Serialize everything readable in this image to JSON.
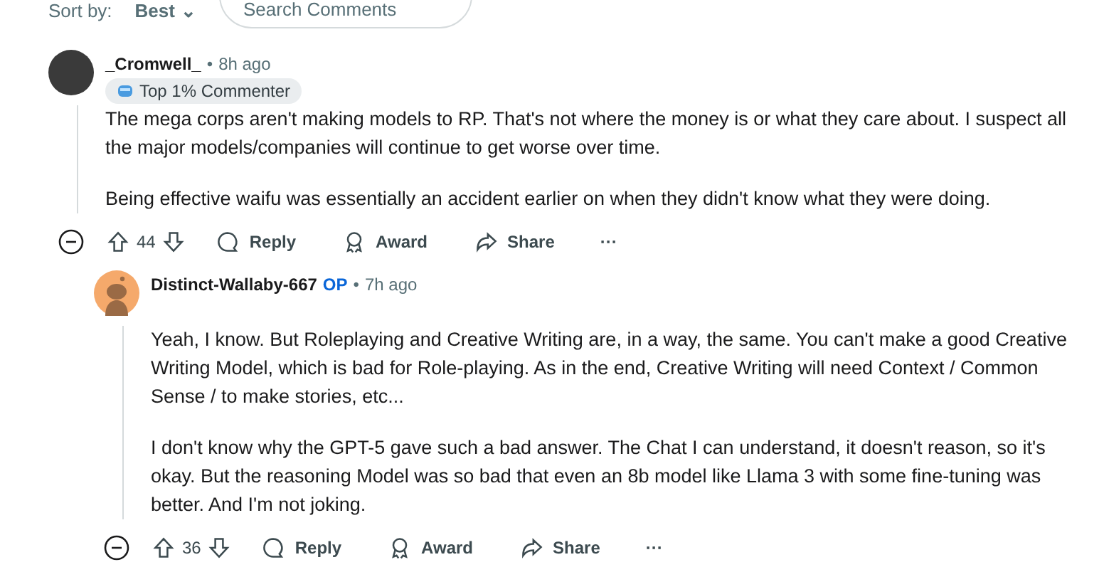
{
  "sort": {
    "label": "Sort by:",
    "value": "Best",
    "caret": "⌄"
  },
  "search": {
    "placeholder": "Search Comments"
  },
  "comments": [
    {
      "author": "_Cromwell_",
      "op": false,
      "separator": "•",
      "time": "8h ago",
      "avatar_photo": true,
      "flair": "Top 1% Commenter",
      "paragraphs": [
        "The mega corps aren't making models to RP. That's not where the money is or what they care about. I suspect all the major models/companies will continue to get worse over time.",
        "Being effective waifu was essentially an accident earlier on when they didn't know what they were doing."
      ],
      "votes": "44",
      "actions": [
        "Reply",
        "Award",
        "Share"
      ],
      "more": "···",
      "children": [
        {
          "author": "Distinct-Wallaby-667",
          "op": true,
          "op_label": "OP",
          "separator": "•",
          "time": "7h ago",
          "avatar_photo": false,
          "paragraphs": [
            "Yeah, I know. But Roleplaying and Creative Writing are, in a way, the same. You can't make a good Creative Writing Model, which is bad for Role-playing. As in the end, Creative Writing will need Context / Common Sense / to make stories, etc...",
            "I don't know why the GPT-5 gave such a bad answer. The Chat I can understand, it doesn't reason, so it's okay. But the reasoning Model was so bad that even an 8b model like Llama 3 with some fine-tuning was better. And I'm not joking."
          ],
          "votes": "36",
          "actions": [
            "Reply",
            "Award",
            "Share"
          ],
          "more": "···"
        }
      ]
    }
  ]
}
